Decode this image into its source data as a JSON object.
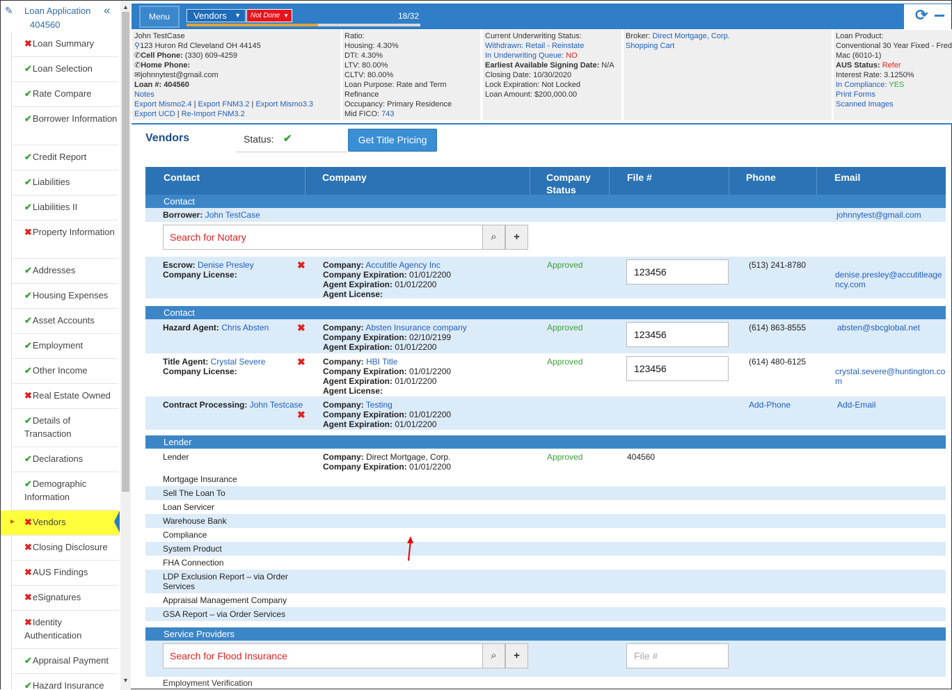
{
  "sidebar": {
    "title": "Loan Application",
    "loan_number": "404560",
    "items": [
      {
        "label": "Loan Summary",
        "status": "bad"
      },
      {
        "label": "Loan Selection",
        "status": "ok"
      },
      {
        "label": "Rate Compare",
        "status": "ok"
      },
      {
        "label": "Borrower Information",
        "status": "ok"
      },
      {
        "label": "Credit Report",
        "status": "ok"
      },
      {
        "label": "Liabilities",
        "status": "ok"
      },
      {
        "label": "Liabilities II",
        "status": "ok"
      },
      {
        "label": "Property Information",
        "status": "bad"
      },
      {
        "label": "Addresses",
        "status": "ok"
      },
      {
        "label": "Housing Expenses",
        "status": "ok"
      },
      {
        "label": "Asset Accounts",
        "status": "ok"
      },
      {
        "label": "Employment",
        "status": "ok"
      },
      {
        "label": "Other Income",
        "status": "ok"
      },
      {
        "label": "Real Estate Owned",
        "status": "bad"
      },
      {
        "label": "Details of Transaction",
        "status": "ok"
      },
      {
        "label": "Declarations",
        "status": "ok"
      },
      {
        "label": "Demographic Information",
        "status": "ok"
      },
      {
        "label": "Vendors",
        "status": "bad",
        "active": true
      },
      {
        "label": "Closing Disclosure",
        "status": "bad"
      },
      {
        "label": "AUS Findings",
        "status": "bad"
      },
      {
        "label": "eSignatures",
        "status": "bad"
      },
      {
        "label": "Identity Authentication",
        "status": "bad"
      },
      {
        "label": "Appraisal Payment",
        "status": "ok"
      },
      {
        "label": "Hazard Insurance",
        "status": "ok"
      }
    ]
  },
  "topbar": {
    "menu_label": "Menu",
    "section_label": "Vendors",
    "status_label": "Not Done",
    "progress_text": "18/32",
    "progress_fraction": 0.5625
  },
  "info": {
    "borrower": {
      "name": "John TestCase",
      "address": "123 Huron Rd Cleveland OH 44145",
      "cell_label": "Cell Phone:",
      "cell": "(330) 609-4259",
      "home_label": "Home Phone:",
      "email": "johnnytest@gmail.com",
      "loan_label": "Loan #:",
      "loan_number": "404560",
      "notes": "Notes",
      "export1": "Export Mismo2.4",
      "export2": "Export FNM3.2",
      "export3": "Export Mismo3.3",
      "export4": "Export UCD",
      "reimport": "Re-Import FNM3.2"
    },
    "ratio": {
      "title": "Ratio:",
      "housing": "Housing: 4.30%",
      "dti": "DTI: 4.30%",
      "ltv": "LTV: 80.00%",
      "cltv": "CLTV: 80.00%",
      "purpose": "Loan Purpose: Rate and Term",
      "purpose2": "Refinance",
      "occupancy": "Occupancy: Primary Residence",
      "fico_label": "Mid FICO: ",
      "fico": "743"
    },
    "underwriting": {
      "title": "Current Underwriting Status:",
      "withdrawn": "Withdrawn: Retail - Reinstate",
      "queue_label": "In Underwriting Queue:",
      "queue_value": "NO",
      "signing_label": "Earliest Available Signing Date:",
      "signing_value": "N/A",
      "closing": "Closing Date: 10/30/2020",
      "lock": "Lock Expiration: Not Locked",
      "amount": "Loan Amount: $200,000.00"
    },
    "broker": {
      "label": "Broker:",
      "name": "Direct Mortgage, Corp.",
      "cart": "Shopping Cart"
    },
    "product": {
      "label": "Loan Product:",
      "name": "Conventional 30 Year Fixed - Fred",
      "name2": "Mac (6010-1)",
      "aus_label": "AUS Status:",
      "aus_value": "Refer",
      "rate": "Interest Rate: 3.1250%",
      "compliance_label": "In Compliance:",
      "compliance_value": "YES",
      "print": "Print Forms",
      "scanned": "Scanned Images"
    }
  },
  "main": {
    "title": "Vendors",
    "status_label": "Status:",
    "title_pricing_button": "Get Title Pricing",
    "columns": [
      "Contact",
      "Company",
      "Company Status",
      "File #",
      "Phone",
      "Email"
    ],
    "sections": {
      "contact1": "Contact",
      "contact2": "Contact",
      "lender": "Lender",
      "service": "Service Providers"
    },
    "borrower_row": {
      "label": "Borrower:",
      "name": "John TestCase",
      "email": "johnnytest@gmail.com"
    },
    "notary_search_placeholder": "Search for Notary",
    "escrow": {
      "label": "Escrow:",
      "name": "Denise Presley",
      "license_label": "Company License:",
      "company_label": "Company:",
      "company": "Accutitle Agency Inc",
      "cexp": "Company Expiration:",
      "cexp_val": "01/01/2200",
      "aexp": "Agent Expiration:",
      "aexp_val": "01/01/2200",
      "alic": "Agent License:",
      "status": "Approved",
      "file": "123456",
      "phone": "(513) 241-8780",
      "email1": "denise.presley@accutitleage",
      "email2": "ncy.com"
    },
    "hazard": {
      "label": "Hazard Agent:",
      "name": "Chris Absten",
      "company_label": "Company:",
      "company": "Absten Insurance company",
      "cexp": "Company Expiration:",
      "cexp_val": "02/10/2199",
      "aexp": "Agent Expiration:",
      "aexp_val": "01/01/2200",
      "status": "Approved",
      "file": "123456",
      "phone": "(614) 863-8555",
      "email": "absten@sbcglobal.net"
    },
    "title_agent": {
      "label": "Title Agent:",
      "name": "Crystal Severe",
      "license_label": "Company License:",
      "company_label": "Company:",
      "company": "HBI Title",
      "cexp": "Company Expiration:",
      "cexp_val": "01/01/2200",
      "aexp": "Agent Expiration:",
      "aexp_val": "01/01/2200",
      "alic": "Agent License:",
      "status": "Approved",
      "file": "123456",
      "phone": "(614) 480-6125",
      "email1": "crystal.severe@huntington.co",
      "email2": "m"
    },
    "contract": {
      "label": "Contract Processing:",
      "name": "John Testcase",
      "company_label": "Company:",
      "company": "Testing",
      "cexp": "Company Expiration:",
      "cexp_val": "01/01/2200",
      "aexp": "Agent Expiration:",
      "aexp_val": "01/01/2200",
      "phone": "Add-Phone",
      "email": "Add-Email"
    },
    "lender_row": {
      "label": "Lender",
      "company_label": "Company:",
      "company": "Direct Mortgage, Corp.",
      "cexp": "Company Expiration:",
      "cexp_val": "01/01/2200",
      "status": "Approved",
      "file": "404560"
    },
    "lender_list": [
      "Mortgage Insurance",
      "Sell The Loan To",
      "Loan Servicer",
      "Warehouse Bank",
      "Compliance",
      "System Product",
      "FHA Connection",
      "LDP Exclusion Report – via Order",
      "Appraisal Management Company",
      "GSA Report – via Order Services"
    ],
    "ldp_line2": "Services",
    "flood_search_placeholder": "Search for Flood Insurance",
    "file_placeholder": "File #",
    "employment_verification": "Employment Verification"
  }
}
